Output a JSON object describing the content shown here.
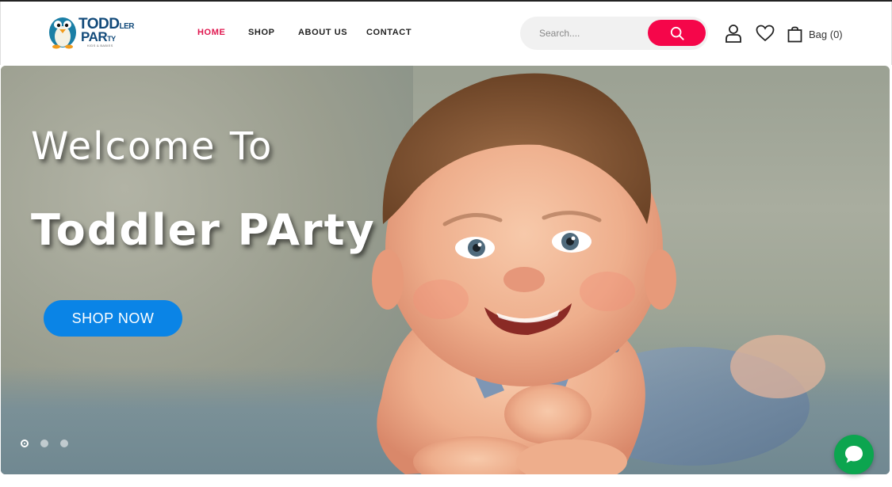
{
  "logo": {
    "line1": "TODD",
    "line1_small": "LER",
    "line2": "PAR",
    "line2_small": "TY",
    "tagline": "KIDS & BABIES"
  },
  "nav": {
    "items": [
      {
        "label": "HOME",
        "active": true
      },
      {
        "label": "SHOP",
        "active": false
      },
      {
        "label": "ABOUT US",
        "active": false
      },
      {
        "label": "CONTACT",
        "active": false
      }
    ]
  },
  "search": {
    "placeholder": "Search...."
  },
  "bag": {
    "label": "Bag (0)"
  },
  "hero": {
    "title_line1": "Welcome To",
    "title_line2": "Toddler PArty",
    "cta": "SHOP NOW",
    "slides": 3,
    "active_slide": 1
  },
  "colors": {
    "accent": "#f5064a",
    "cta_blue": "#0a84e6",
    "chat_green": "#0ca54f",
    "logo_blue": "#124a7a"
  },
  "icons": {
    "search": "search-icon",
    "account": "user-icon",
    "wishlist": "heart-icon",
    "bag": "bag-icon",
    "chat": "chat-icon"
  }
}
